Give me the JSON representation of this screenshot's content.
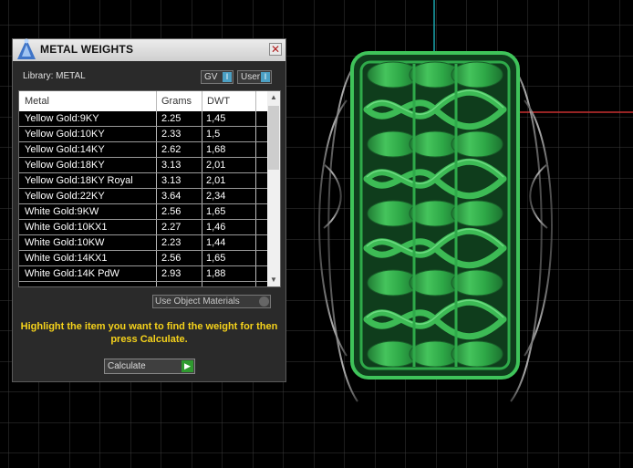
{
  "panel": {
    "title": "METAL WEIGHTS",
    "close_glyph": "✕",
    "library_label": "Library: METAL",
    "toggles": [
      {
        "label": "GV",
        "state": "I"
      },
      {
        "label": "User",
        "state": "I"
      }
    ],
    "table": {
      "columns": [
        "Metal",
        "Grams",
        "DWT"
      ],
      "rows": [
        [
          "Yellow Gold:9KY",
          "2.25",
          "1,45"
        ],
        [
          "Yellow Gold:10KY",
          "2.33",
          "1,5"
        ],
        [
          "Yellow Gold:14KY",
          "2.62",
          "1,68"
        ],
        [
          "Yellow Gold:18KY",
          "3.13",
          "2,01"
        ],
        [
          "Yellow Gold:18KY Royal",
          "3.13",
          "2,01"
        ],
        [
          "Yellow Gold:22KY",
          "3.64",
          "2,34"
        ],
        [
          "White Gold:9KW",
          "2.56",
          "1,65"
        ],
        [
          "White Gold:10KX1",
          "2.27",
          "1,46"
        ],
        [
          "White Gold:10KW",
          "2.23",
          "1,44"
        ],
        [
          "White Gold:14KX1",
          "2.56",
          "1,65"
        ],
        [
          "White Gold:14K PdW",
          "2.93",
          "1,88"
        ]
      ]
    },
    "use_materials_label": "Use Object Materials",
    "instructions": "Highlight the item you want to find the weight for then press Calculate.",
    "calculate_label": "Calculate",
    "icons": {
      "logo": "app-logo-icon",
      "close": "close-icon",
      "go": "play-arrow-icon"
    }
  },
  "viewport": {
    "description_colors": {
      "grid": "#3a3a3a",
      "ring": "#2faa4a",
      "axis_y": "#1aa7b0",
      "axis_x": "#c83030"
    }
  }
}
